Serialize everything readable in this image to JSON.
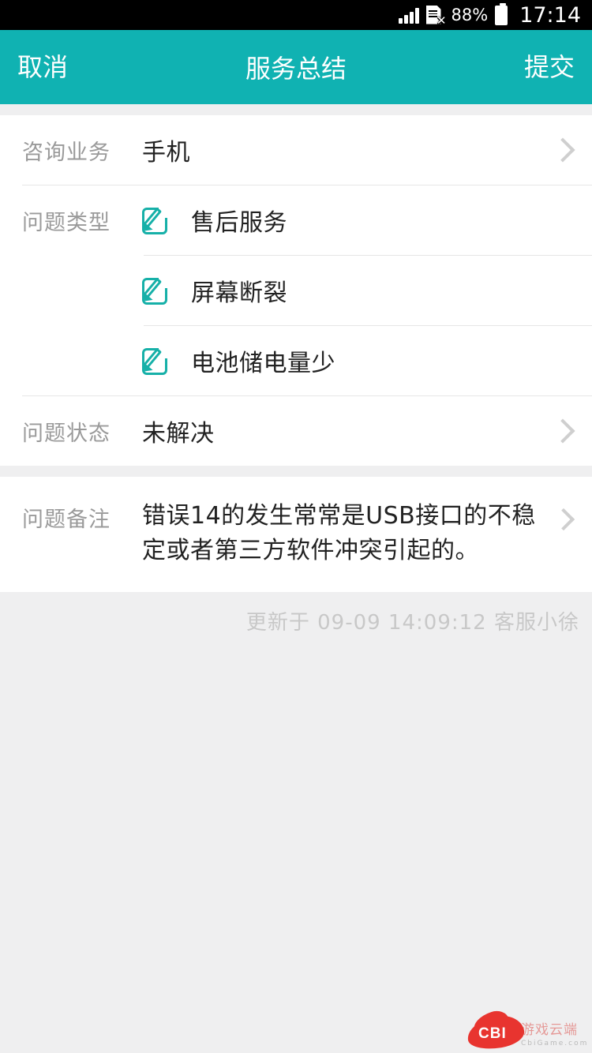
{
  "status_bar": {
    "signal_icon": "signal-bars-icon",
    "sim_icon": "sim-card-disabled-icon",
    "battery_percent": "88%",
    "battery_icon": "battery-icon",
    "time": "17:14"
  },
  "nav": {
    "cancel_label": "取消",
    "title": "服务总结",
    "submit_label": "提交"
  },
  "form": {
    "business": {
      "label": "咨询业务",
      "value": "手机",
      "chevron_icon": "chevron-right-icon"
    },
    "problem_type": {
      "label": "问题类型",
      "items": [
        {
          "icon": "edit-pencil-icon",
          "text": "售后服务"
        },
        {
          "icon": "edit-pencil-icon",
          "text": "屏幕断裂"
        },
        {
          "icon": "edit-pencil-icon",
          "text": "电池储电量少"
        }
      ]
    },
    "problem_status": {
      "label": "问题状态",
      "value": "未解决",
      "chevron_icon": "chevron-right-icon"
    },
    "problem_note": {
      "label": "问题备注",
      "value": "错误14的发生常常是USB接口的不稳定或者第三方软件冲突引起的。",
      "chevron_icon": "chevron-right-icon"
    },
    "updated": "更新于  09-09 14:09:12 客服小徐"
  },
  "watermark": {
    "mark": "CBI",
    "name": "游戏云端",
    "url": "CbiGame.com"
  },
  "colors": {
    "accent": "#10b2b2",
    "icon_teal": "#16b0a8",
    "page_bg": "#efeff0",
    "label_gray": "#9a9a9a",
    "watermark_red": "#e8251f"
  }
}
